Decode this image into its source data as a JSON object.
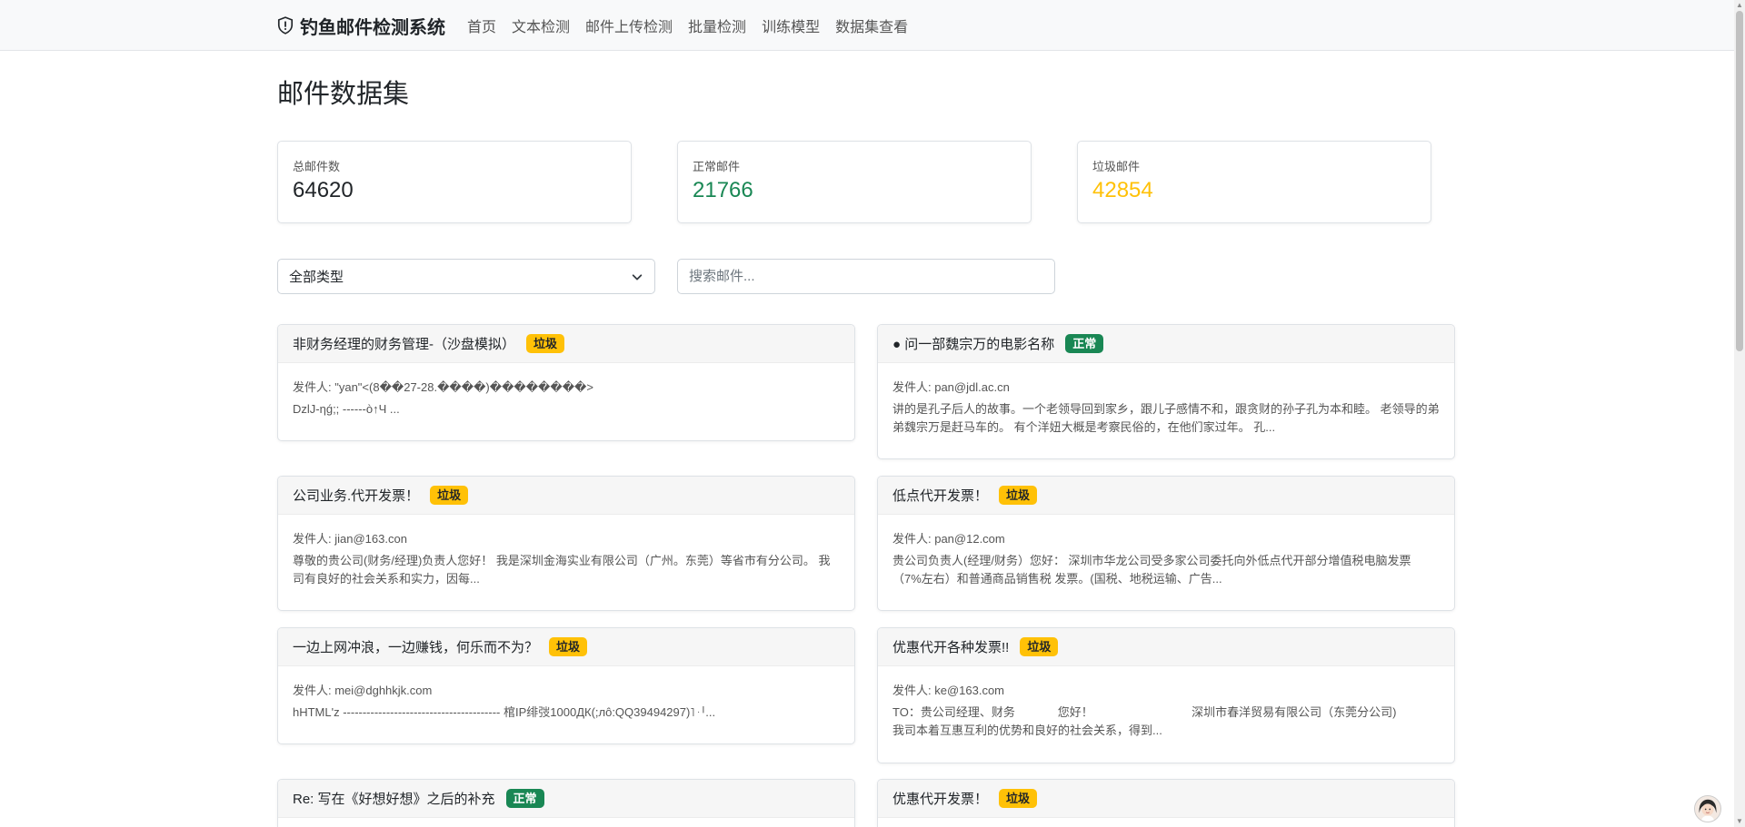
{
  "navbar": {
    "brand": "钓鱼邮件检测系统",
    "links": [
      "首页",
      "文本检测",
      "邮件上传检测",
      "批量检测",
      "训练模型",
      "数据集查看"
    ]
  },
  "page": {
    "title": "邮件数据集"
  },
  "stats": [
    {
      "label": "总邮件数",
      "value": "64620",
      "color": "#212529"
    },
    {
      "label": "正常邮件",
      "value": "21766",
      "color": "#198754"
    },
    {
      "label": "垃圾邮件",
      "value": "42854",
      "color": "#ffc107"
    }
  ],
  "filter": {
    "selected": "全部类型"
  },
  "search": {
    "placeholder": "搜索邮件..."
  },
  "badges": {
    "spam": "垃圾",
    "ham": "正常"
  },
  "emails": [
    {
      "title": "非财务经理的财务管理-（沙盘模拟）",
      "label": "垃圾",
      "type": "spam",
      "sender": "发件人: \"yan\"<(8��27-28.����)��������>",
      "preview": "DzlJ-ηǵ;; ------ò↑Ч ..."
    },
    {
      "title": "● 问一部魏宗万的电影名称",
      "label": "正常",
      "type": "ham",
      "sender": "发件人: pan@jdl.ac.cn",
      "preview": "讲的是孔子后人的故事。一个老领导回到家乡，跟儿子感情不和，跟贪财的孙子孔为本和睦。 老领导的弟弟魏宗万是赶马车的。 有个洋妞大概是考察民俗的，在他们家过年。 孔..."
    },
    {
      "title": "公司业务.代开发票！",
      "label": "垃圾",
      "type": "spam",
      "sender": "发件人: jian@163.con",
      "preview": "尊敬的贵公司(财务/经理)负责人您好！ 我是深圳金海实业有限公司（广州。东莞）等省市有分公司。 我司有良好的社会关系和实力，因每..."
    },
    {
      "title": "低点代开发票！",
      "label": "垃圾",
      "type": "spam",
      "sender": "发件人: pan@12.com",
      "preview": "贵公司负责人(经理/财务）您好： 深圳市华龙公司受多家公司委托向外低点代开部分增值税电脑发票（7%左右）和普通商品销售税 发票。(国税、地税运输、广告..."
    },
    {
      "title": "一边上网冲浪，一边赚钱，何乐而不为？",
      "label": "垃圾",
      "type": "spam",
      "sender": "发件人: mei@dghhkjk.com",
      "preview": "hHTML'z ---------------------------------------- 棺IP绯弢1000ДК(;лô:QQ39494297)˥ᆡ..."
    },
    {
      "title": "优惠代开各种发票!!",
      "label": "垃圾",
      "type": "spam",
      "sender": "发件人: ke@163.com",
      "preview": "TO：贵公司经理、财务             您好！                              深圳市春洋贸易有限公司（东莞分公司)            我司本着互惠互利的优势和良好的社会关系，得到..."
    },
    {
      "title": "Re: 写在《好想好想》之后的补充",
      "label": "正常",
      "type": "ham",
      "sender": "",
      "preview": ""
    },
    {
      "title": "优惠代开发票！",
      "label": "垃圾",
      "type": "spam",
      "sender": "",
      "preview": ""
    }
  ]
}
